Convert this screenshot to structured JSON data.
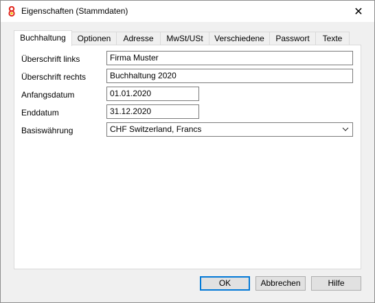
{
  "window": {
    "title": "Eigenschaften (Stammdaten)",
    "close_glyph": "✕",
    "app_icon": "banana-logo-icon"
  },
  "tabs": [
    {
      "label": "Buchhaltung",
      "active": true
    },
    {
      "label": "Optionen",
      "active": false
    },
    {
      "label": "Adresse",
      "active": false
    },
    {
      "label": "MwSt/USt",
      "active": false
    },
    {
      "label": "Verschiedene",
      "active": false
    },
    {
      "label": "Passwort",
      "active": false
    },
    {
      "label": "Texte",
      "active": false
    }
  ],
  "form": {
    "heading_left_label": "Überschrift links",
    "heading_left_value": "Firma Muster",
    "heading_right_label": "Überschrift rechts",
    "heading_right_value": "Buchhaltung 2020",
    "start_date_label": "Anfangsdatum",
    "start_date_value": "01.01.2020",
    "end_date_label": "Enddatum",
    "end_date_value": "31.12.2020",
    "base_currency_label": "Basiswährung",
    "base_currency_value": "CHF Switzerland, Francs"
  },
  "buttons": {
    "ok": "OK",
    "cancel": "Abbrechen",
    "help": "Hilfe"
  },
  "colors": {
    "accent": "#0078d7",
    "logo_red": "#e2231a",
    "logo_yellow": "#f6c800"
  }
}
